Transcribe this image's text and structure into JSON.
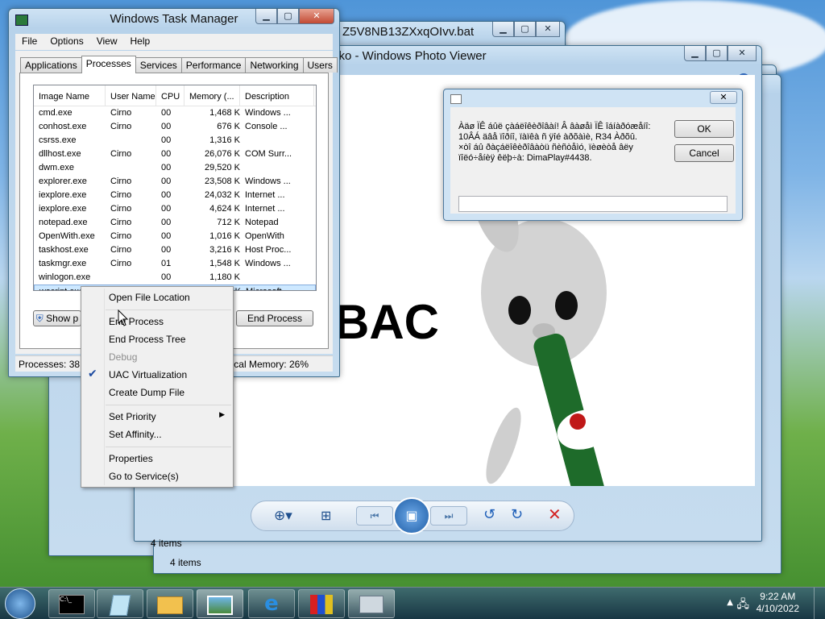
{
  "task_manager": {
    "title": "Windows Task Manager",
    "menu": [
      "File",
      "Options",
      "View",
      "Help"
    ],
    "tabs": [
      "Applications",
      "Processes",
      "Services",
      "Performance",
      "Networking",
      "Users"
    ],
    "active_tab": "Processes",
    "columns": [
      "Image Name",
      "User Name",
      "CPU",
      "Memory (...",
      "Description"
    ],
    "rows": [
      [
        "cmd.exe",
        "Cirno",
        "00",
        "1,468 K",
        "Windows ..."
      ],
      [
        "conhost.exe",
        "Cirno",
        "00",
        "676 K",
        "Console ..."
      ],
      [
        "csrss.exe",
        "",
        "00",
        "1,316 K",
        ""
      ],
      [
        "dllhost.exe",
        "Cirno",
        "00",
        "26,076 K",
        "COM Surr..."
      ],
      [
        "dwm.exe",
        "",
        "00",
        "29,520 K",
        ""
      ],
      [
        "explorer.exe",
        "Cirno",
        "00",
        "23,508 K",
        "Windows ..."
      ],
      [
        "iexplore.exe",
        "Cirno",
        "00",
        "24,032 K",
        "Internet ..."
      ],
      [
        "iexplore.exe",
        "Cirno",
        "00",
        "4,624 K",
        "Internet ..."
      ],
      [
        "notepad.exe",
        "Cirno",
        "00",
        "712 K",
        "Notepad"
      ],
      [
        "OpenWith.exe",
        "Cirno",
        "00",
        "1,016 K",
        "OpenWith"
      ],
      [
        "taskhost.exe",
        "Cirno",
        "00",
        "3,216 K",
        "Host Proc..."
      ],
      [
        "taskmgr.exe",
        "Cirno",
        "01",
        "1,548 K",
        "Windows ..."
      ],
      [
        "winlogon.exe",
        "",
        "00",
        "1,180 K",
        ""
      ],
      [
        "wscript.exe",
        "",
        "",
        "K",
        "Microsoft ..."
      ]
    ],
    "show_processes_label": "Show p",
    "end_process_label": "End Process",
    "status_processes": "Processes: 38",
    "status_memory": "cal Memory: 26%"
  },
  "context_menu": {
    "items": [
      {
        "label": "Open File Location"
      },
      {
        "label": "End Process"
      },
      {
        "label": "End Process Tree"
      },
      {
        "label": "Debug"
      },
      {
        "label": "UAC Virtualization"
      },
      {
        "label": "Create Dump File"
      },
      {
        "label": "Set Priority"
      },
      {
        "label": "Set Affinity..."
      },
      {
        "label": "Properties"
      },
      {
        "label": "Go to Service(s)"
      }
    ]
  },
  "back_window": {
    "title": "Z5V8NB13ZXxqOIvv.bat"
  },
  "photo_viewer": {
    "title": "vko - Windows Photo Viewer",
    "image_text": "BAC",
    "items_count": "4 items"
  },
  "behind_windows": {
    "items_count": "4 items"
  },
  "dialog": {
    "text": "Àäø ÏÊ áûë çàáëîêèðîâàí! Â âàøåì ÏÊ îáíàðóæåíî: 10ÂÁ äâå ïîðíî, ïàïêà ñ ÿîé àðõàìè, R34 Àðõû.\n×òî áû ðàçáëîêèðîâàòü ñèñòåìó, ïèøèòå âëy ïîëó÷åíèÿ êëþ÷à: DimaPlay#4438.",
    "ok_label": "OK",
    "cancel_label": "Cancel"
  },
  "taskbar": {
    "time": "9:22 AM",
    "date": "4/10/2022"
  }
}
